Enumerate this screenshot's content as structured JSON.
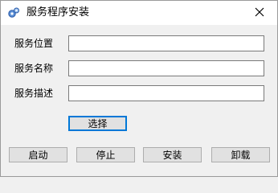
{
  "window": {
    "title": "服务程序安装",
    "icon": "gears-icon",
    "close_icon": "close-icon"
  },
  "form": {
    "fields": [
      {
        "label": "服务位置",
        "value": "",
        "placeholder": ""
      },
      {
        "label": "服务名称",
        "value": "",
        "placeholder": ""
      },
      {
        "label": "服务描述",
        "value": "",
        "placeholder": ""
      }
    ],
    "browse_label": "选择"
  },
  "actions": {
    "start_label": "启动",
    "stop_label": "停止",
    "install_label": "安装",
    "uninstall_label": "卸载"
  },
  "colors": {
    "titlebar": "#ffffff",
    "body": "#f0f0f0",
    "accent": "#0078d7"
  }
}
